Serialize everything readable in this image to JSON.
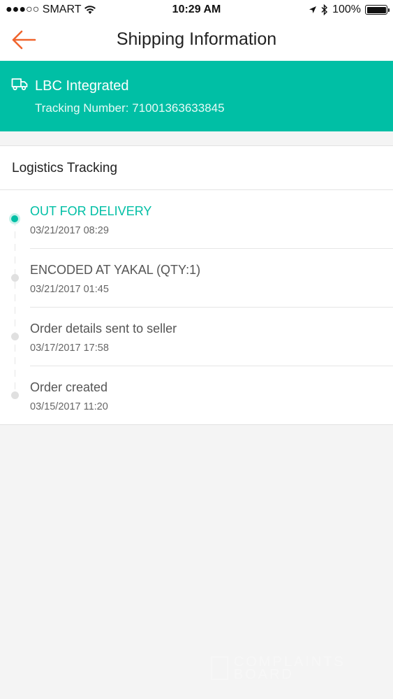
{
  "status_bar": {
    "carrier": "●●●○○ SMART",
    "time": "10:29 AM",
    "battery": "100%"
  },
  "header": {
    "title": "Shipping Information"
  },
  "shipment": {
    "carrier_name": "LBC Integrated",
    "tracking_label": "Tracking Number: 71001363633845"
  },
  "tracking": {
    "section_title": "Logistics Tracking",
    "events": [
      {
        "title": "OUT FOR DELIVERY",
        "time": "03/21/2017 08:29",
        "active": true
      },
      {
        "title": "ENCODED AT YAKAL (QTY:1)",
        "time": "03/21/2017 01:45",
        "active": false
      },
      {
        "title": "Order details sent to seller",
        "time": "03/17/2017 17:58",
        "active": false
      },
      {
        "title": "Order created",
        "time": "03/15/2017 11:20",
        "active": false
      }
    ]
  },
  "watermark": {
    "text": "COMPLAINTS BOARD"
  },
  "colors": {
    "accent": "#00bfa5",
    "back_arrow": "#f0642d",
    "background": "#f4f4f4"
  }
}
